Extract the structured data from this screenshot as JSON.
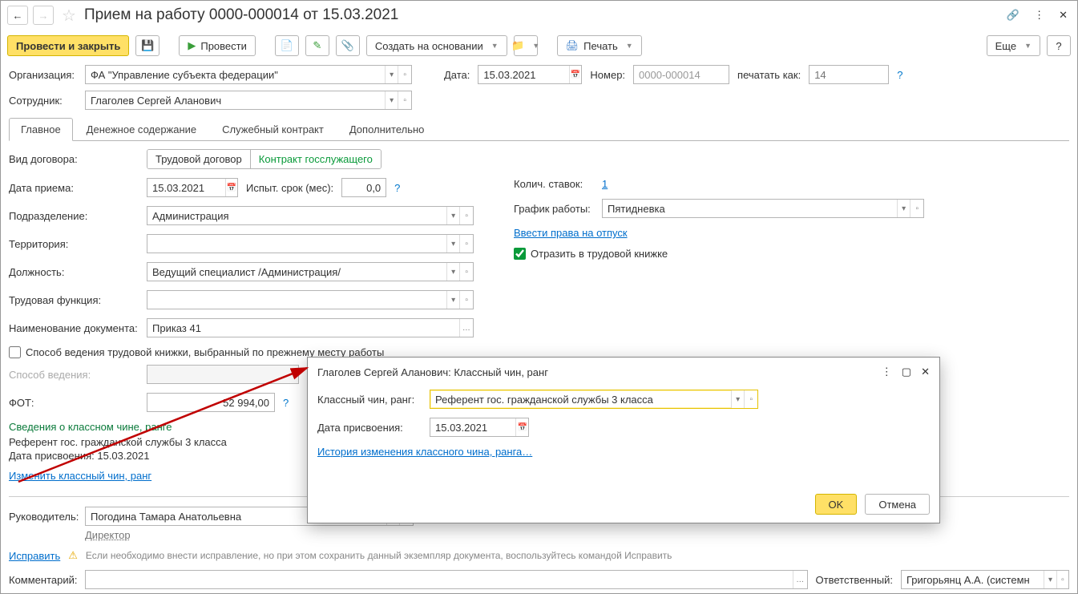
{
  "title": "Прием на работу 0000-000014 от 15.03.2021",
  "toolbar": {
    "post_close": "Провести и закрыть",
    "post": "Провести",
    "create_based": "Создать на основании",
    "print": "Печать",
    "more": "Еще",
    "help": "?"
  },
  "header": {
    "org_label": "Организация:",
    "org_value": "ФА \"Управление субъекта федерации\"",
    "date_label": "Дата:",
    "date_value": "15.03.2021",
    "number_label": "Номер:",
    "number_value": "0000-000014",
    "print_as_label": "печатать как:",
    "print_as_value": "14",
    "employee_label": "Сотрудник:",
    "employee_value": "Глаголев Сергей Аланович"
  },
  "tabs": [
    "Главное",
    "Денежное содержание",
    "Служебный контракт",
    "Дополнительно"
  ],
  "main": {
    "contract_type_label": "Вид договора:",
    "contract_type_opts": [
      "Трудовой договор",
      "Контракт госслужащего"
    ],
    "hire_date_label": "Дата приема:",
    "hire_date_value": "15.03.2021",
    "probation_label": "Испыт. срок (мес):",
    "probation_value": "0,0",
    "department_label": "Подразделение:",
    "department_value": "Администрация",
    "territory_label": "Территория:",
    "territory_value": "",
    "position_label": "Должность:",
    "position_value": "Ведущий специалист /Администрация/",
    "work_function_label": "Трудовая функция:",
    "work_function_value": "",
    "doc_name_label": "Наименование документа:",
    "doc_name_value": "Приказ 41",
    "workbook_prev_label": "Способ ведения трудовой книжки, выбранный по прежнему месту работы",
    "method_label": "Способ ведения:",
    "fot_label": "ФОТ:",
    "fot_value": "52 994,00",
    "rank_title": "Сведения о классном чине, ранге",
    "rank_value": "Референт гос. гражданской службы 3 класса",
    "rank_date": "Дата присвоения: 15.03.2021",
    "rank_change": "Изменить классный чин, ранг",
    "rates_label": "Колич. ставок:",
    "rates_value": "1",
    "schedule_label": "График работы:",
    "schedule_value": "Пятидневка",
    "vacation_link": "Ввести права на отпуск",
    "workbook_reflect": "Отразить в трудовой книжке"
  },
  "footer": {
    "manager_label": "Руководитель:",
    "manager_value": "Погодина Тамара Анатольевна",
    "manager_role": "Директор",
    "fix_link": "Исправить",
    "fix_hint": "Если необходимо внести исправление, но при этом сохранить данный экземпляр документа, воспользуйтесь командой Исправить",
    "comment_label": "Комментарий:",
    "responsible_label": "Ответственный:",
    "responsible_value": "Григорьянц А.А. (системн"
  },
  "popup": {
    "title": "Глаголев Сергей Аланович: Классный чин, ранг",
    "rank_label": "Классный чин, ранг:",
    "rank_value": "Референт гос. гражданской службы 3 класса",
    "date_label": "Дата присвоения:",
    "date_value": "15.03.2021",
    "history_link": "История изменения классного чина, ранга…",
    "ok": "OK",
    "cancel": "Отмена"
  }
}
